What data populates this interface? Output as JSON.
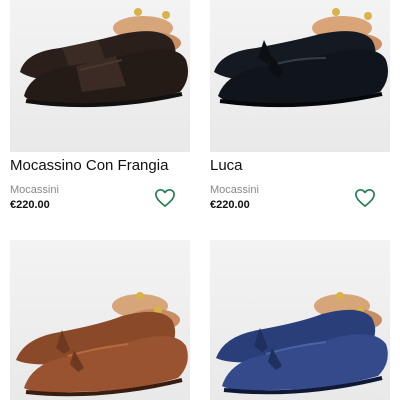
{
  "colors": {
    "accent": "#1f7a4d",
    "background": "#ffffff"
  },
  "products": [
    {
      "name": "Mocassino Con Frangia",
      "category": "Mocassini",
      "price": "€220.00",
      "wishlist_icon": "heart-outline-icon"
    },
    {
      "name": "Luca",
      "category": "Mocassini",
      "price": "€220.00",
      "wishlist_icon": "heart-outline-icon"
    },
    {
      "name": "",
      "category": "",
      "price": "",
      "wishlist_icon": ""
    },
    {
      "name": "",
      "category": "",
      "price": "",
      "wishlist_icon": ""
    }
  ]
}
